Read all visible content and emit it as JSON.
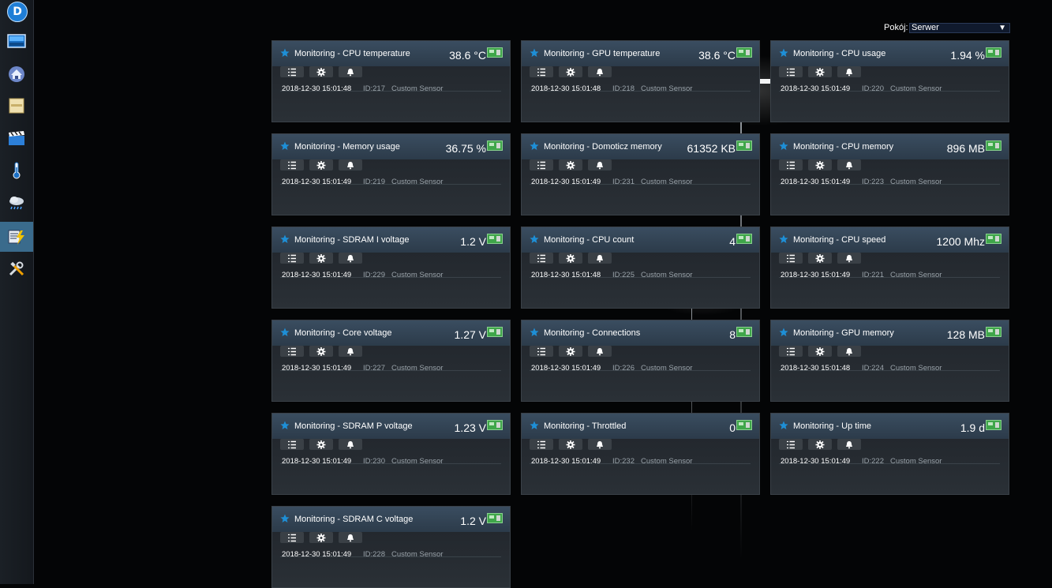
{
  "header": {
    "room_label": "Pokój:",
    "room_selected": "Serwer",
    "room_arrow": "▼"
  },
  "sidebar": {
    "logo_letter": "D",
    "items": [
      {
        "name": "dashboard-icon"
      },
      {
        "name": "floorplan-icon"
      },
      {
        "name": "lights-icon"
      },
      {
        "name": "scenes-icon"
      },
      {
        "name": "temperature-icon"
      },
      {
        "name": "weather-icon"
      },
      {
        "name": "utility-icon",
        "active": true
      },
      {
        "name": "setup-icon"
      }
    ]
  },
  "devices": [
    {
      "name": "Monitoring - CPU temperature",
      "value": "38.6 °C",
      "date": "2018-12-30 15:01:48",
      "id": "ID:217",
      "type": "Custom Sensor"
    },
    {
      "name": "Monitoring - GPU temperature",
      "value": "38.6 °C",
      "date": "2018-12-30 15:01:48",
      "id": "ID:218",
      "type": "Custom Sensor"
    },
    {
      "name": "Monitoring - CPU usage",
      "value": "1.94 %",
      "date": "2018-12-30 15:01:49",
      "id": "ID:220",
      "type": "Custom Sensor"
    },
    {
      "name": "Monitoring - Memory usage",
      "value": "36.75 %",
      "date": "2018-12-30 15:01:49",
      "id": "ID:219",
      "type": "Custom Sensor"
    },
    {
      "name": "Monitoring - Domoticz memory",
      "value": "61352 KB",
      "date": "2018-12-30 15:01:49",
      "id": "ID:231",
      "type": "Custom Sensor"
    },
    {
      "name": "Monitoring - CPU memory",
      "value": "896 MB",
      "date": "2018-12-30 15:01:49",
      "id": "ID:223",
      "type": "Custom Sensor"
    },
    {
      "name": "Monitoring - SDRAM I voltage",
      "value": "1.2 V",
      "date": "2018-12-30 15:01:49",
      "id": "ID:229",
      "type": "Custom Sensor"
    },
    {
      "name": "Monitoring - CPU count",
      "value": "4",
      "date": "2018-12-30 15:01:48",
      "id": "ID:225",
      "type": "Custom Sensor"
    },
    {
      "name": "Monitoring - CPU speed",
      "value": "1200 Mhz",
      "date": "2018-12-30 15:01:49",
      "id": "ID:221",
      "type": "Custom Sensor"
    },
    {
      "name": "Monitoring - Core voltage",
      "value": "1.27 V",
      "date": "2018-12-30 15:01:49",
      "id": "ID:227",
      "type": "Custom Sensor"
    },
    {
      "name": "Monitoring - Connections",
      "value": "8",
      "date": "2018-12-30 15:01:49",
      "id": "ID:226",
      "type": "Custom Sensor"
    },
    {
      "name": "Monitoring - GPU memory",
      "value": "128 MB",
      "date": "2018-12-30 15:01:48",
      "id": "ID:224",
      "type": "Custom Sensor"
    },
    {
      "name": "Monitoring - SDRAM P voltage",
      "value": "1.23 V",
      "date": "2018-12-30 15:01:49",
      "id": "ID:230",
      "type": "Custom Sensor"
    },
    {
      "name": "Monitoring - Throttled",
      "value": "0",
      "date": "2018-12-30 15:01:49",
      "id": "ID:232",
      "type": "Custom Sensor"
    },
    {
      "name": "Monitoring - Up time",
      "value": "1.9 d",
      "date": "2018-12-30 15:01:49",
      "id": "ID:222",
      "type": "Custom Sensor"
    },
    {
      "name": "Monitoring - SDRAM C voltage",
      "value": "1.2 V",
      "date": "2018-12-30 15:01:49",
      "id": "ID:228",
      "type": "Custom Sensor"
    }
  ],
  "colors": {
    "accent_star": "#1e8fd6",
    "sensor_green": "#3fa64a",
    "active_nav": "#3a6b8c"
  }
}
